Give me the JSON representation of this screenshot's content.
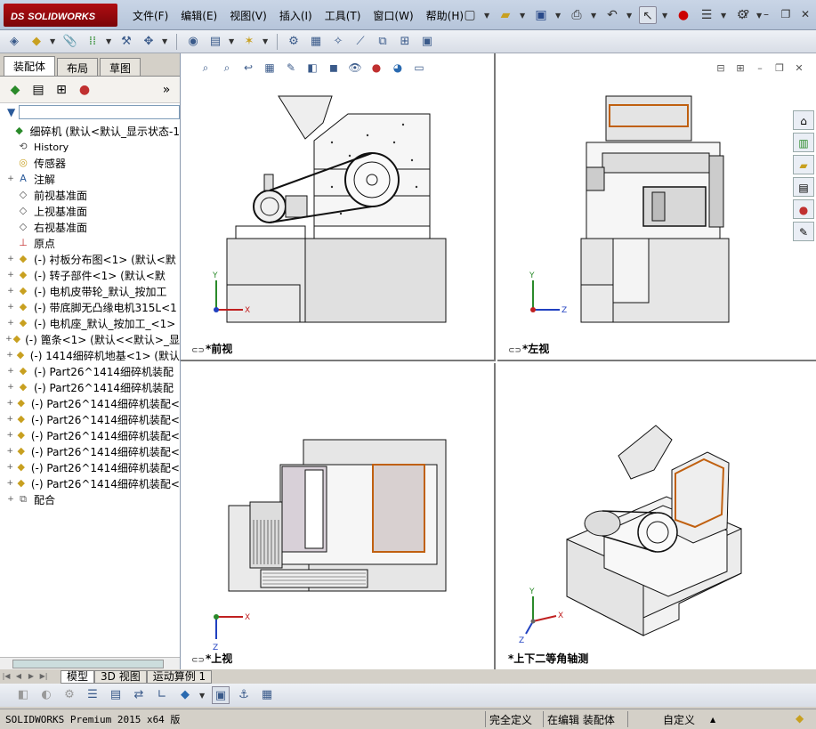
{
  "app": {
    "logo_prefix": "DS",
    "logo_text": "SOLIDWORKS"
  },
  "menu": [
    "文件(F)",
    "编辑(E)",
    "视图(V)",
    "插入(I)",
    "工具(T)",
    "窗口(W)",
    "帮助(H)"
  ],
  "panel": {
    "tabs": [
      "装配体",
      "布局",
      "草图"
    ],
    "tree": [
      {
        "exp": "",
        "icon": "assembly-icon",
        "label": "细碎机  (默认<默认_显示状态-1",
        "mono": false
      },
      {
        "exp": "",
        "icon": "history-icon",
        "label": "History",
        "mono": true
      },
      {
        "exp": "",
        "icon": "sensor-icon",
        "label": "传感器",
        "mono": false
      },
      {
        "exp": "+",
        "icon": "annotation-icon",
        "label": "注解",
        "mono": false
      },
      {
        "exp": "",
        "icon": "plane-icon",
        "label": "前视基准面",
        "mono": false
      },
      {
        "exp": "",
        "icon": "plane-icon",
        "label": "上视基准面",
        "mono": false
      },
      {
        "exp": "",
        "icon": "plane-icon",
        "label": "右视基准面",
        "mono": false
      },
      {
        "exp": "",
        "icon": "origin-icon",
        "label": "原点",
        "mono": false
      },
      {
        "exp": "+",
        "icon": "subassembly-icon",
        "label": "(-) 衬板分布图<1> (默认<默",
        "mono": false
      },
      {
        "exp": "+",
        "icon": "subassembly-icon",
        "label": "(-) 转子部件<1> (默认<默",
        "mono": false
      },
      {
        "exp": "+",
        "icon": "part-icon",
        "label": "(-) 电机皮带轮_默认_按加工",
        "mono": false
      },
      {
        "exp": "+",
        "icon": "part-icon",
        "label": "(-) 带底脚无凸缘电机315L<1",
        "mono": false
      },
      {
        "exp": "+",
        "icon": "part-icon",
        "label": "(-) 电机座_默认_按加工_<1>",
        "mono": false
      },
      {
        "exp": "+",
        "icon": "part-icon",
        "label": "(-) 篦条<1> (默认<<默认>_显",
        "mono": false
      },
      {
        "exp": "+",
        "icon": "part-icon",
        "label": "(-) 1414细碎机地基<1> (默认",
        "mono": false
      },
      {
        "exp": "+",
        "icon": "part-icon",
        "label": "(-) Part26^1414细碎机装配",
        "mono": false
      },
      {
        "exp": "+",
        "icon": "part-icon",
        "label": "(-) Part26^1414细碎机装配",
        "mono": false
      },
      {
        "exp": "+",
        "icon": "part-icon",
        "label": "(-) Part26^1414细碎机装配<",
        "mono": false
      },
      {
        "exp": "+",
        "icon": "part-icon",
        "label": "(-) Part26^1414细碎机装配<",
        "mono": false
      },
      {
        "exp": "+",
        "icon": "part-icon",
        "label": "(-) Part26^1414细碎机装配<",
        "mono": false
      },
      {
        "exp": "+",
        "icon": "part-icon",
        "label": "(-) Part26^1414细碎机装配<",
        "mono": false
      },
      {
        "exp": "+",
        "icon": "part-icon",
        "label": "(-) Part26^1414细碎机装配<",
        "mono": false
      },
      {
        "exp": "+",
        "icon": "part-icon",
        "label": "(-) Part26^1414细碎机装配<",
        "mono": false
      },
      {
        "exp": "+",
        "icon": "mates-icon",
        "label": "配合",
        "mono": false
      }
    ]
  },
  "viewports": {
    "front": "*前视",
    "left": "*左视",
    "top": "*上视",
    "iso": "*上下二等角轴测"
  },
  "axes": {
    "x": "X",
    "y": "Y",
    "z": "Z"
  },
  "bottom_tabs": [
    "模型",
    "3D 视图",
    "运动算例 1"
  ],
  "status": {
    "version": "SOLIDWORKS Premium 2015 x64 版",
    "fully_defined": "完全定义",
    "editing": "在编辑 装配体",
    "custom": "自定义"
  }
}
